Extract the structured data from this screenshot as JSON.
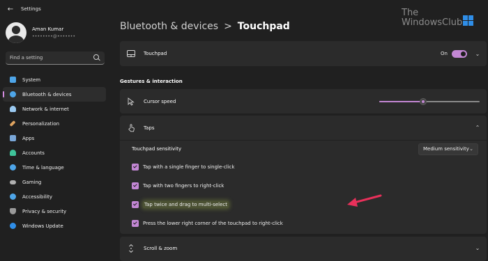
{
  "window": {
    "title": "Settings"
  },
  "user": {
    "name": "Aman Kumar",
    "email": "••••••••@•••••••"
  },
  "search": {
    "placeholder": "Find a setting"
  },
  "sidebar": {
    "items": [
      {
        "label": "System",
        "icon": "monitor-icon",
        "color": "#4ea5e8",
        "active": false
      },
      {
        "label": "Bluetooth & devices",
        "icon": "bluetooth-icon",
        "color": "#4ea5e8",
        "active": true
      },
      {
        "label": "Network & internet",
        "icon": "wifi-icon",
        "color": "#9ac9f0",
        "active": false
      },
      {
        "label": "Personalization",
        "icon": "brush-icon",
        "color": "#e0a460",
        "active": false
      },
      {
        "label": "Apps",
        "icon": "apps-icon",
        "color": "#7aa7d8",
        "active": false
      },
      {
        "label": "Accounts",
        "icon": "person-icon",
        "color": "#3fc39a",
        "active": false
      },
      {
        "label": "Time & language",
        "icon": "globe-clock-icon",
        "color": "#4ea5e8",
        "active": false
      },
      {
        "label": "Gaming",
        "icon": "gamepad-icon",
        "color": "#b0b0b0",
        "active": false
      },
      {
        "label": "Accessibility",
        "icon": "accessibility-icon",
        "color": "#4ea5e8",
        "active": false
      },
      {
        "label": "Privacy & security",
        "icon": "shield-icon",
        "color": "#9a9a9a",
        "active": false
      },
      {
        "label": "Windows Update",
        "icon": "update-icon",
        "color": "#2f8ee8",
        "active": false
      }
    ]
  },
  "breadcrumb": {
    "parent": "Bluetooth & devices",
    "separator": ">",
    "current": "Touchpad"
  },
  "watermark": {
    "line1": "The",
    "line2": "WindowsClub"
  },
  "touchpad": {
    "label": "Touchpad",
    "state_label": "On",
    "enabled": true
  },
  "gestures": {
    "heading": "Gestures & interaction"
  },
  "cursor_speed": {
    "label": "Cursor speed",
    "value": 0.44
  },
  "taps": {
    "label": "Taps",
    "sensitivity_label": "Touchpad sensitivity",
    "sensitivity_value": "Medium sensitivity",
    "options": [
      {
        "label": "Tap with a single finger to single-click",
        "checked": true,
        "highlight": false
      },
      {
        "label": "Tap with two fingers to right-click",
        "checked": true,
        "highlight": false
      },
      {
        "label": "Tap twice and drag to multi-select",
        "checked": true,
        "highlight": true
      },
      {
        "label": "Press the lower right corner of the touchpad to right-click",
        "checked": true,
        "highlight": false
      }
    ]
  },
  "scroll_zoom": {
    "label": "Scroll & zoom"
  },
  "colors": {
    "accent": "#c387d4",
    "arrow": "#e8305a",
    "background": "#202020",
    "card": "#2b2b2b"
  }
}
